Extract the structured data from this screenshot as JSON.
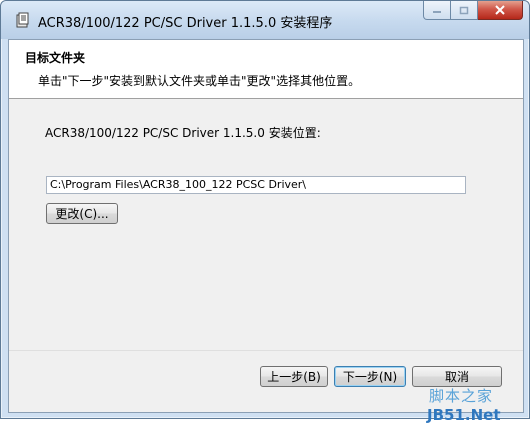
{
  "window": {
    "title": "ACR38/100/122 PC/SC Driver 1.1.5.0 安装程序"
  },
  "header": {
    "title": "目标文件夹",
    "subtitle": "单击\"下一步\"安装到默认文件夹或单击\"更改\"选择其他位置。"
  },
  "body": {
    "location_label": "ACR38/100/122 PC/SC Driver 1.1.5.0 安装位置:",
    "install_path": "C:\\Program Files\\ACR38_100_122 PCSC Driver\\",
    "change_button": "更改(C)..."
  },
  "footer": {
    "back_button": "上一步(B)",
    "next_button": "下一步(N)",
    "cancel_button": "取消"
  },
  "watermark": {
    "cn": "脚本之家",
    "en": "JB51.Net"
  }
}
